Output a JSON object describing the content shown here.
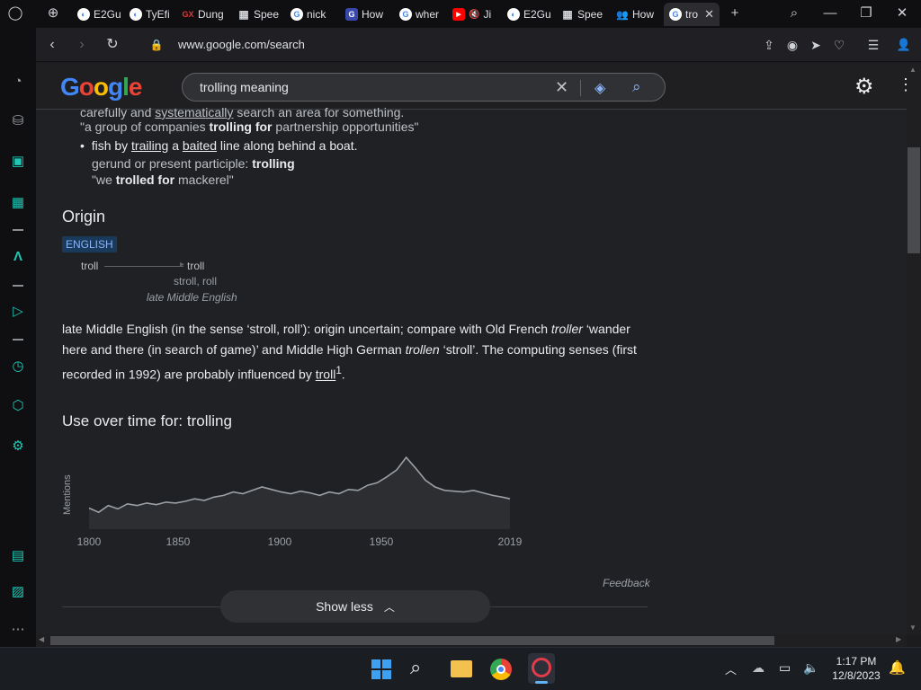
{
  "tabs": [
    {
      "label": "E2Gu",
      "icon": "opera-gx-icon"
    },
    {
      "label": "TyEfi",
      "icon": "opera-gx-icon"
    },
    {
      "label": "Dung",
      "icon": "gx-icon"
    },
    {
      "label": "Spee",
      "icon": "speed-dial-icon"
    },
    {
      "label": "nick",
      "icon": "google-icon"
    },
    {
      "label": "How",
      "icon": "g-icon"
    },
    {
      "label": "wher",
      "icon": "google-icon"
    },
    {
      "label": "Ji",
      "icon": "youtube-icon"
    },
    {
      "label": "E2Gu",
      "icon": "opera-gx-icon"
    },
    {
      "label": "Spee",
      "icon": "speed-dial-icon"
    },
    {
      "label": "How",
      "icon": "people-icon"
    },
    {
      "label": "tro",
      "icon": "google-icon",
      "active": true
    }
  ],
  "address": {
    "url": "www.google.com/search"
  },
  "search": {
    "query": "trolling meaning"
  },
  "definition": {
    "line_cut_1": "carefully and",
    "line_cut_2": "systematically",
    "line_cut_3": "search an area for something.",
    "ex1_a": "\"a group of companies",
    "ex1_b": "trolling for",
    "ex1_c": "partnership opportunities\"",
    "bullet_a": "fish by",
    "bullet_b": "trailing",
    "bullet_c": "a",
    "bullet_d": "baited",
    "bullet_e": "line along behind a boat.",
    "gerund_a": "gerund or present participle:",
    "gerund_b": "trolling",
    "ex2_a": "\"we",
    "ex2_b": "trolled for",
    "ex2_c": "mackerel\""
  },
  "origin": {
    "heading": "Origin",
    "badge": "ENGLISH",
    "from": "troll",
    "to": "troll",
    "sense": "stroll, roll",
    "period": "late Middle English",
    "p_a": "late Middle English (in the sense ‘stroll, roll’): origin uncertain; compare with Old French",
    "p_b": "troller",
    "p_c": "‘wander here and there (in search of game)’ and Middle High German",
    "p_d": "trollen",
    "p_e": "‘stroll’. The computing senses (first recorded in 1992) are probably influenced by",
    "p_f": "troll",
    "p_sup": "1",
    "p_g": "."
  },
  "usage": {
    "heading": "Use over time for: trolling",
    "ylabel": "Mentions",
    "ticks": [
      "1800",
      "1850",
      "1900",
      "1950",
      "2019"
    ]
  },
  "chart_data": {
    "type": "line",
    "title": "Use over time for: trolling",
    "ylabel": "Mentions",
    "xlabel": "",
    "x": [
      1800,
      1805,
      1810,
      1815,
      1820,
      1825,
      1830,
      1835,
      1840,
      1845,
      1850,
      1855,
      1860,
      1865,
      1870,
      1875,
      1880,
      1885,
      1890,
      1895,
      1900,
      1905,
      1910,
      1915,
      1920,
      1925,
      1930,
      1935,
      1940,
      1945,
      1950,
      1955,
      1960,
      1965,
      1970,
      1975,
      1980,
      1985,
      1990,
      1995,
      2000,
      2005,
      2010,
      2015,
      2019
    ],
    "values": [
      25,
      20,
      28,
      24,
      30,
      28,
      31,
      29,
      32,
      31,
      33,
      36,
      34,
      38,
      40,
      44,
      42,
      46,
      50,
      47,
      44,
      42,
      45,
      43,
      40,
      44,
      42,
      47,
      46,
      52,
      55,
      62,
      70,
      85,
      72,
      58,
      50,
      46,
      45,
      44,
      46,
      43,
      40,
      38,
      36
    ],
    "ylim": [
      0,
      100
    ],
    "grid": false,
    "legend": "none"
  },
  "feedback": "Feedback",
  "show_less": "Show less",
  "taskbar": {
    "time": "1:17 PM",
    "date": "12/8/2023"
  }
}
